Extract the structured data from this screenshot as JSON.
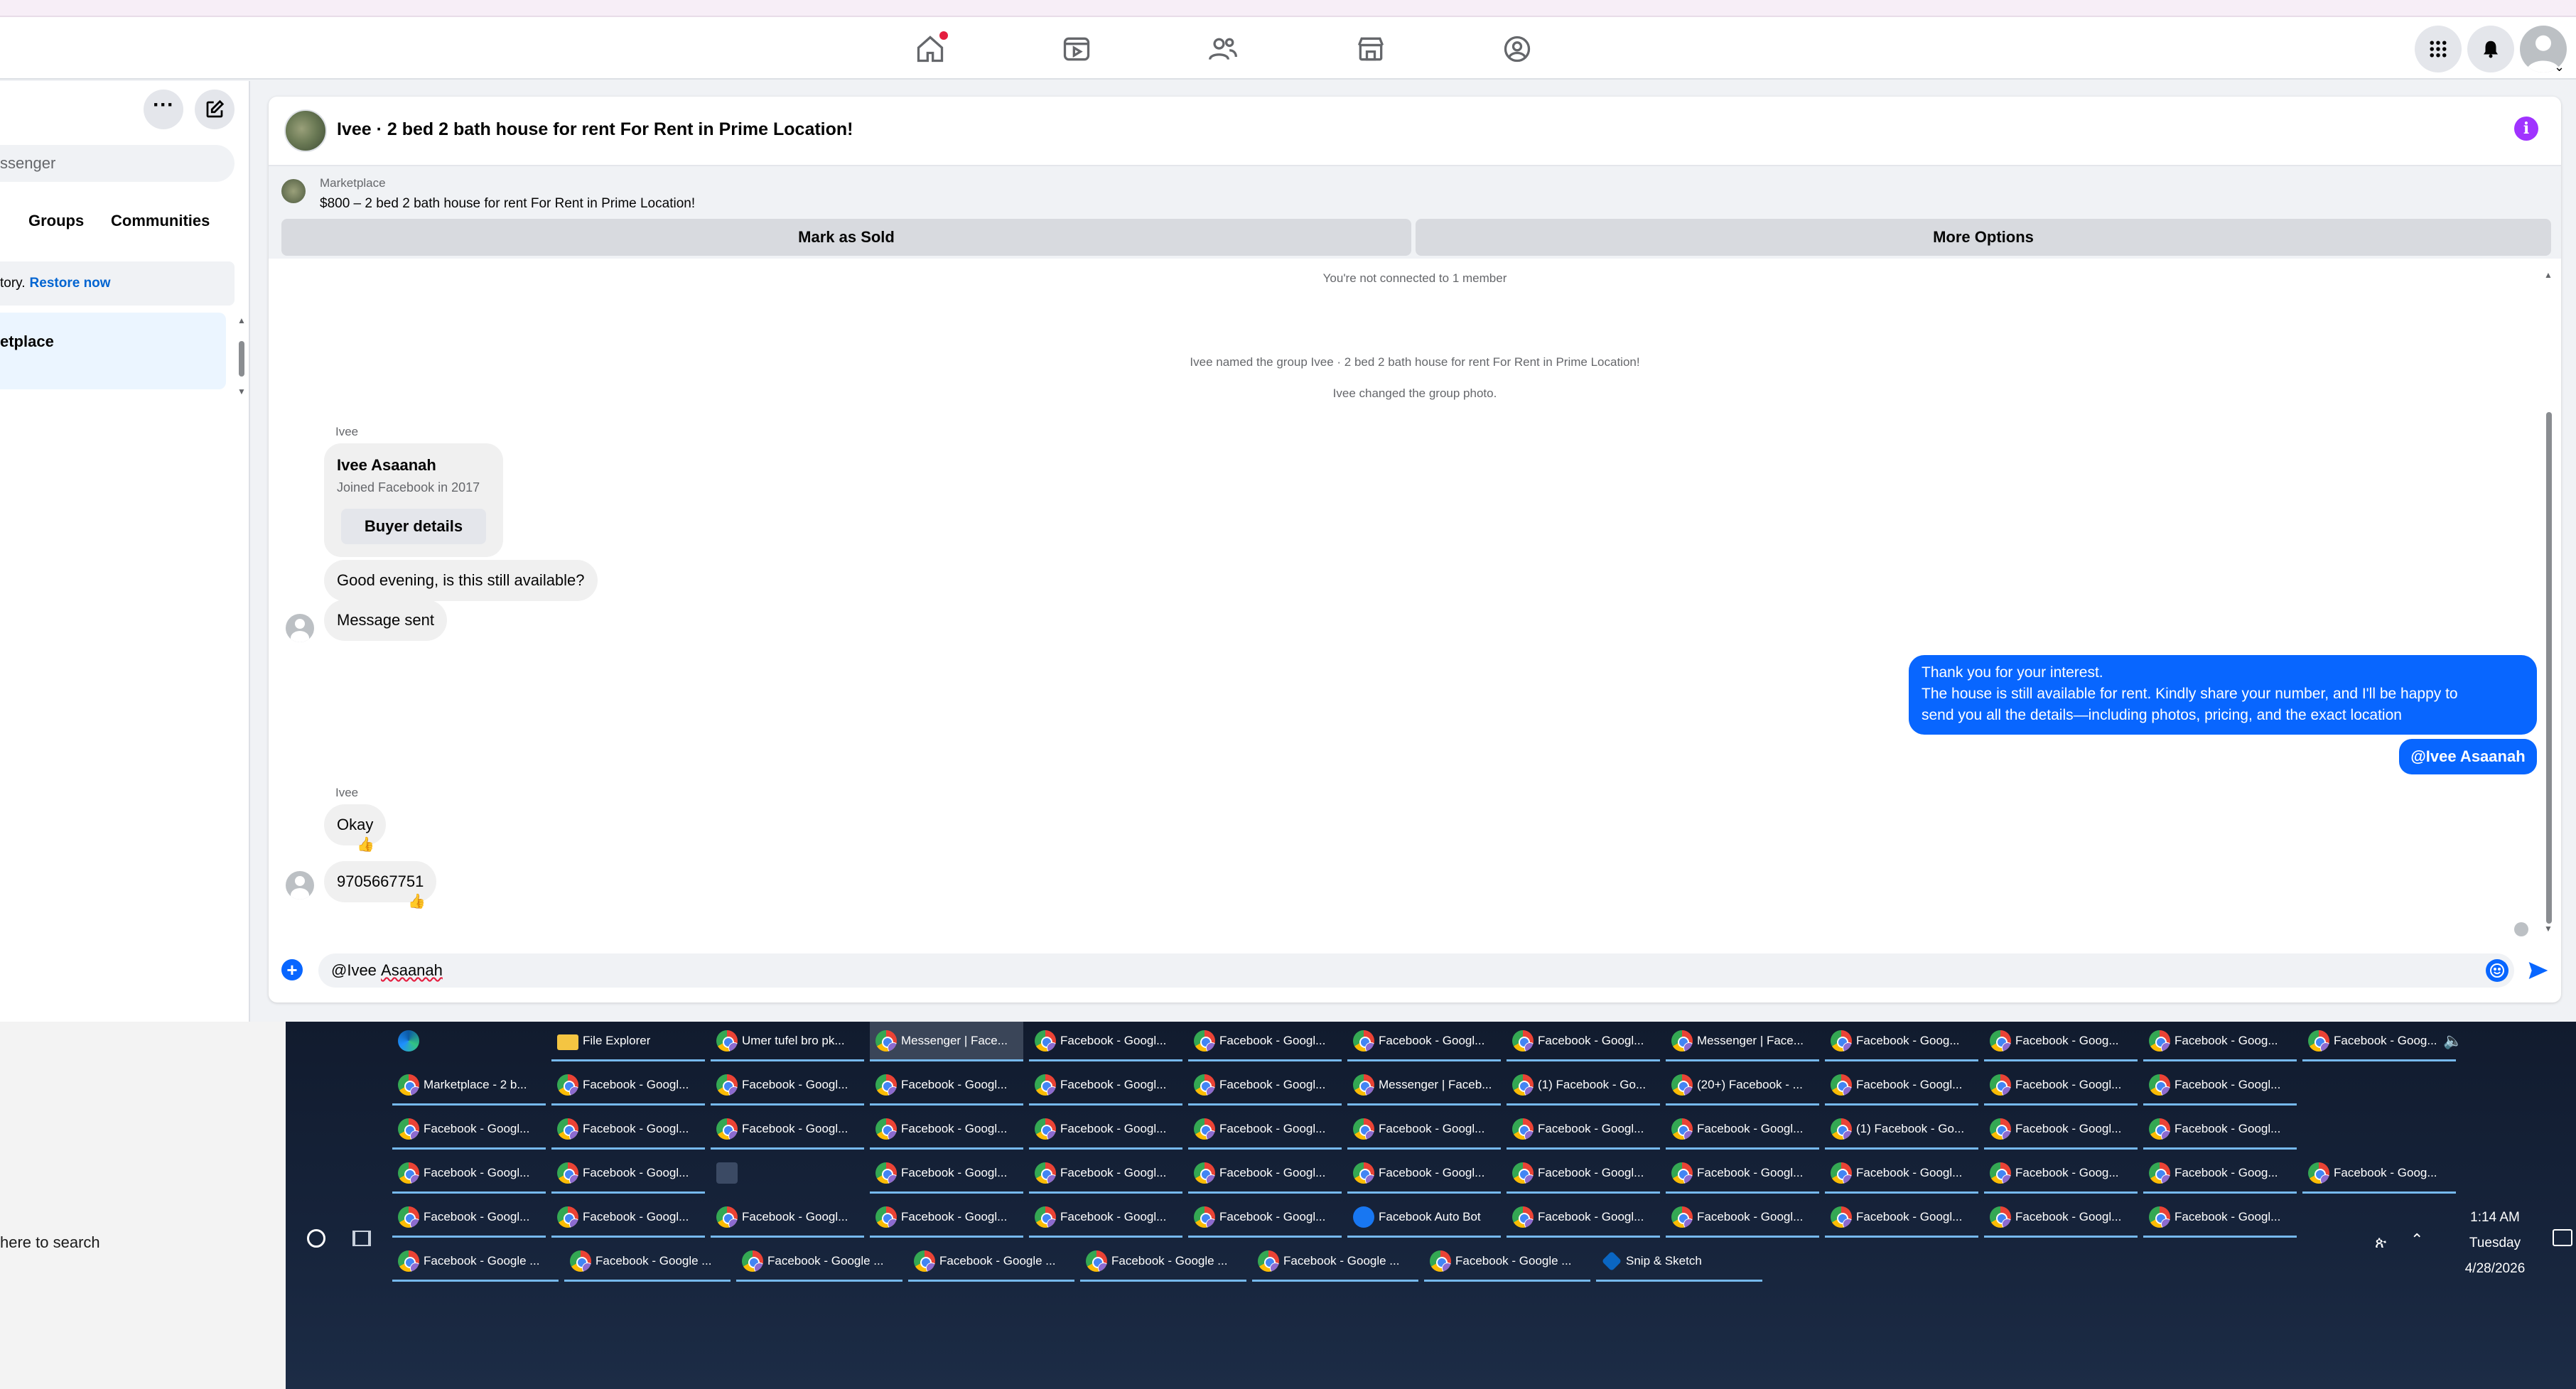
{
  "sidebar": {
    "search_placeholder": "ssenger",
    "tabs": [
      "Groups",
      "Communities"
    ],
    "restore_text": "tory.",
    "restore_link": "Restore now",
    "selected_item": "etplace"
  },
  "chat": {
    "title": "Ivee · 2 bed 2 bath house for rent For Rent in Prime Location!",
    "marketplace_label": "Marketplace",
    "listing_text": "$800 – 2 bed 2 bath house for rent For Rent in Prime Location!",
    "mark_sold": "Mark as Sold",
    "more_options": "More Options",
    "not_connected": "You're not connected to 1 member",
    "system_messages": [
      "Ivee named the group Ivee · 2 bed 2 bath house for rent For Rent in Prime Location!",
      "Ivee changed the group photo."
    ],
    "sender_name": "Ivee",
    "buyer_card": {
      "name": "Ivee Asaanah",
      "joined": "Joined Facebook in 2017",
      "button": "Buyer details"
    },
    "incoming_1": "Good evening, is this still available?",
    "incoming_2": "Message sent",
    "outgoing_lines": [
      "Thank you for your interest.",
      "The house is still available for rent. Kindly share your number, and I'll be happy to",
      "send you all the details—including photos, pricing, and the exact location"
    ],
    "outgoing_mention": "@Ivee Asaanah",
    "incoming_3": "Okay",
    "incoming_4": "9705667751",
    "reaction": "👍",
    "composer_prefix": "@Ivee ",
    "composer_name": "Asaanah",
    "accent_color": "#0866ff"
  },
  "taskbar": {
    "search_text": "here to search",
    "rows": [
      [
        {
          "icon": "edge-icon",
          "label": ""
        },
        {
          "icon": "folder-icon",
          "label": "File Explorer"
        },
        {
          "icon": "chrome-icon",
          "label": "Umer tufel bro pk..."
        },
        {
          "icon": "chrome-icon",
          "label": "Messenger | Face..."
        },
        {
          "icon": "chrome-icon",
          "label": "Facebook - Googl..."
        },
        {
          "icon": "chrome-icon",
          "label": "Facebook - Googl..."
        },
        {
          "icon": "chrome-icon",
          "label": "Facebook - Googl..."
        },
        {
          "icon": "chrome-icon",
          "label": "Facebook - Googl..."
        },
        {
          "icon": "chrome-icon",
          "label": "Messenger | Face..."
        },
        {
          "icon": "chrome-icon",
          "label": "Facebook - Goog..."
        },
        {
          "icon": "chrome-icon",
          "label": "Facebook - Goog..."
        },
        {
          "icon": "chrome-icon",
          "label": "Facebook - Goog..."
        },
        {
          "icon": "chrome-icon",
          "label": "Facebook - Goog..."
        }
      ],
      [
        {
          "icon": "chrome-icon",
          "label": "Marketplace - 2 b..."
        },
        {
          "icon": "chrome-icon",
          "label": "Facebook - Googl..."
        },
        {
          "icon": "chrome-icon",
          "label": "Facebook - Googl..."
        },
        {
          "icon": "chrome-icon",
          "label": "Facebook - Googl..."
        },
        {
          "icon": "chrome-icon",
          "label": "Facebook - Googl..."
        },
        {
          "icon": "chrome-icon",
          "label": "Facebook - Googl..."
        },
        {
          "icon": "chrome-icon",
          "label": "Messenger | Faceb..."
        },
        {
          "icon": "chrome-icon",
          "label": "(1) Facebook - Go..."
        },
        {
          "icon": "chrome-icon",
          "label": "(20+) Facebook - ..."
        },
        {
          "icon": "chrome-icon",
          "label": "Facebook - Googl..."
        },
        {
          "icon": "chrome-icon",
          "label": "Facebook - Googl..."
        },
        {
          "icon": "chrome-icon",
          "label": "Facebook - Googl..."
        }
      ],
      [
        {
          "icon": "chrome-icon",
          "label": "Facebook - Googl..."
        },
        {
          "icon": "chrome-icon",
          "label": "Facebook - Googl..."
        },
        {
          "icon": "chrome-icon",
          "label": "Facebook - Googl..."
        },
        {
          "icon": "chrome-icon",
          "label": "Facebook - Googl..."
        },
        {
          "icon": "chrome-icon",
          "label": "Facebook - Googl..."
        },
        {
          "icon": "chrome-icon",
          "label": "Facebook - Googl..."
        },
        {
          "icon": "chrome-icon",
          "label": "Facebook - Googl..."
        },
        {
          "icon": "chrome-icon",
          "label": "Facebook - Googl..."
        },
        {
          "icon": "chrome-icon",
          "label": "Facebook - Googl..."
        },
        {
          "icon": "chrome-icon",
          "label": "(1) Facebook - Go..."
        },
        {
          "icon": "chrome-icon",
          "label": "Facebook - Googl..."
        },
        {
          "icon": "chrome-icon",
          "label": "Facebook - Googl..."
        }
      ],
      [
        {
          "icon": "chrome-icon",
          "label": "Facebook - Googl..."
        },
        {
          "icon": "chrome-icon",
          "label": "Facebook - Googl..."
        },
        {
          "icon": "app-icon",
          "label": ""
        },
        {
          "icon": "chrome-icon",
          "label": "Facebook - Googl..."
        },
        {
          "icon": "chrome-icon",
          "label": "Facebook - Googl..."
        },
        {
          "icon": "chrome-icon",
          "label": "Facebook - Googl..."
        },
        {
          "icon": "chrome-icon",
          "label": "Facebook - Googl..."
        },
        {
          "icon": "chrome-icon",
          "label": "Facebook - Googl..."
        },
        {
          "icon": "chrome-icon",
          "label": "Facebook - Googl..."
        },
        {
          "icon": "chrome-icon",
          "label": "Facebook - Googl..."
        },
        {
          "icon": "chrome-icon",
          "label": "Facebook - Goog..."
        },
        {
          "icon": "chrome-icon",
          "label": "Facebook - Goog..."
        },
        {
          "icon": "chrome-icon",
          "label": "Facebook - Goog..."
        }
      ],
      [
        {
          "icon": "chrome-icon",
          "label": "Facebook - Googl..."
        },
        {
          "icon": "chrome-icon",
          "label": "Facebook - Googl..."
        },
        {
          "icon": "chrome-icon",
          "label": "Facebook - Googl..."
        },
        {
          "icon": "chrome-icon",
          "label": "Facebook - Googl..."
        },
        {
          "icon": "chrome-icon",
          "label": "Facebook - Googl..."
        },
        {
          "icon": "chrome-icon",
          "label": "Facebook - Googl..."
        },
        {
          "icon": "fb-icon",
          "label": "Facebook Auto Bot"
        },
        {
          "icon": "chrome-icon",
          "label": "Facebook - Googl..."
        },
        {
          "icon": "chrome-icon",
          "label": "Facebook - Googl..."
        },
        {
          "icon": "chrome-icon",
          "label": "Facebook - Googl..."
        },
        {
          "icon": "chrome-icon",
          "label": "Facebook - Googl..."
        },
        {
          "icon": "chrome-icon",
          "label": "Facebook - Googl..."
        }
      ],
      [
        {
          "icon": "chrome-icon",
          "label": "Facebook - Google ..."
        },
        {
          "icon": "chrome-icon",
          "label": "Facebook - Google ..."
        },
        {
          "icon": "chrome-icon",
          "label": "Facebook - Google ..."
        },
        {
          "icon": "chrome-icon",
          "label": "Facebook - Google ..."
        },
        {
          "icon": "chrome-icon",
          "label": "Facebook - Google ..."
        },
        {
          "icon": "chrome-icon",
          "label": "Facebook - Google ..."
        },
        {
          "icon": "chrome-icon",
          "label": "Facebook - Google ..."
        },
        {
          "icon": "snip-icon",
          "label": "Snip & Sketch"
        }
      ]
    ],
    "clock_time": "1:14 AM",
    "clock_day": "Tuesday",
    "clock_date": "4/28/2026"
  }
}
